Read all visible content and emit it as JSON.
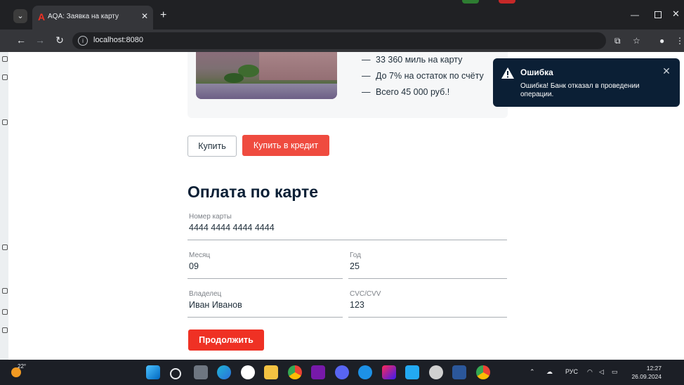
{
  "browser": {
    "tab_title": "AQA: Заявка на карту",
    "tab_favicon": "A",
    "url": "localhost:8080"
  },
  "product": {
    "features": [
      "33 360 миль на карту",
      "До 7% на остаток по счёту",
      "Всего 45 000 руб.!"
    ]
  },
  "buttons": {
    "buy": "Купить",
    "buy_credit": "Купить в кредит",
    "continue": "Продолжить"
  },
  "form": {
    "heading": "Оплата по карте",
    "card_number": {
      "label": "Номер карты",
      "value": "4444 4444 4444 4444"
    },
    "month": {
      "label": "Месяц",
      "value": "09"
    },
    "year": {
      "label": "Год",
      "value": "25"
    },
    "owner": {
      "label": "Владелец",
      "value": "Иван Иванов"
    },
    "cvc": {
      "label": "CVC/CVV",
      "value": "123"
    }
  },
  "notification": {
    "title": "Ошибка",
    "text": "Ошибка! Банк отказал в проведении операции."
  },
  "taskbar": {
    "weather": "22°",
    "language": "РУС",
    "time": "12:27",
    "date": "26.09.2024"
  },
  "colors": {
    "accent_red": "#ef3124",
    "toast_bg": "#0b1f35",
    "heading": "#0b1f35"
  }
}
